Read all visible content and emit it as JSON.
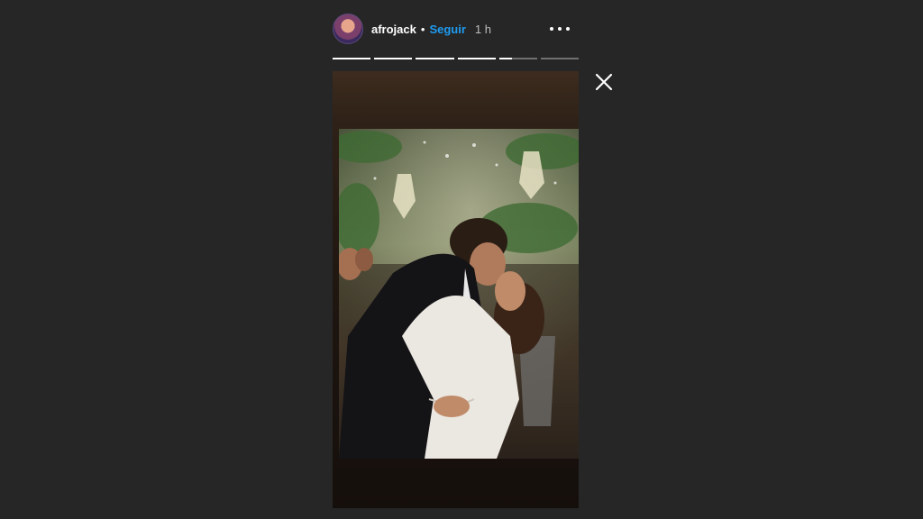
{
  "header": {
    "username": "afrojack",
    "separator": "•",
    "follow_label": "Seguir",
    "time": "1 h",
    "avatar_icon": "profile-avatar",
    "more_icon": "more-horizontal-icon"
  },
  "progress": {
    "segments": 6,
    "current_index": 4,
    "current_fraction": 0.35
  },
  "close_icon": "close-icon",
  "colors": {
    "background": "#262626",
    "follow": "#1e9bf0",
    "text": "#ffffff"
  }
}
